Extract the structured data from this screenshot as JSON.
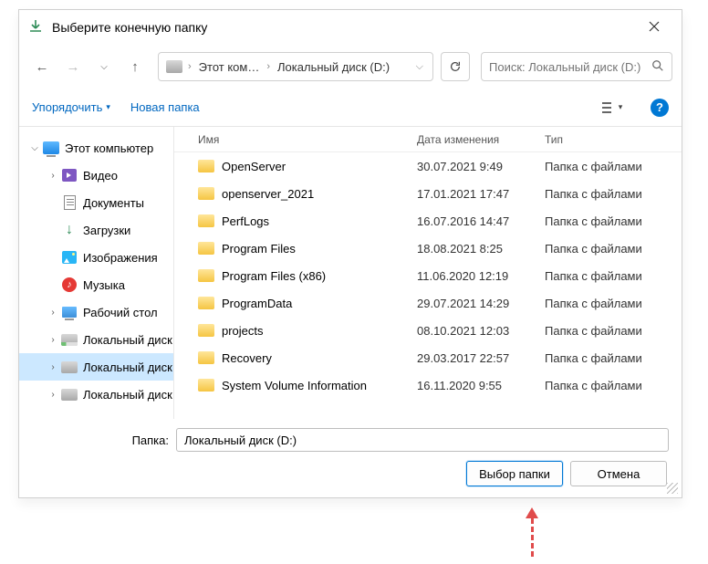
{
  "title": "Выберите конечную папку",
  "nav": {
    "crumb1": "Этот ком…",
    "crumb2": "Локальный диск (D:)"
  },
  "search": {
    "placeholder": "Поиск: Локальный диск (D:)"
  },
  "toolbar": {
    "organize": "Упорядочить",
    "newfolder": "Новая папка"
  },
  "headers": {
    "name": "Имя",
    "modified": "Дата изменения",
    "type": "Тип"
  },
  "sidebar": {
    "root": "Этот компьютер",
    "video": "Видео",
    "documents": "Документы",
    "downloads": "Загрузки",
    "images": "Изображения",
    "music": "Музыка",
    "desktop": "Рабочий стол",
    "localdisk": "Локальный диск"
  },
  "files": [
    {
      "name": "OpenServer",
      "date": "30.07.2021 9:49",
      "type": "Папка с файлами"
    },
    {
      "name": "openserver_2021",
      "date": "17.01.2021 17:47",
      "type": "Папка с файлами"
    },
    {
      "name": "PerfLogs",
      "date": "16.07.2016 14:47",
      "type": "Папка с файлами"
    },
    {
      "name": "Program Files",
      "date": "18.08.2021 8:25",
      "type": "Папка с файлами"
    },
    {
      "name": "Program Files (x86)",
      "date": "11.06.2020 12:19",
      "type": "Папка с файлами"
    },
    {
      "name": "ProgramData",
      "date": "29.07.2021 14:29",
      "type": "Папка с файлами"
    },
    {
      "name": "projects",
      "date": "08.10.2021 12:03",
      "type": "Папка с файлами"
    },
    {
      "name": "Recovery",
      "date": "29.03.2017 22:57",
      "type": "Папка с файлами"
    },
    {
      "name": "System Volume Information",
      "date": "16.11.2020 9:55",
      "type": "Папка с файлами"
    }
  ],
  "bottom": {
    "label": "Папка:",
    "value": "Локальный диск (D:)",
    "select": "Выбор папки",
    "cancel": "Отмена"
  }
}
